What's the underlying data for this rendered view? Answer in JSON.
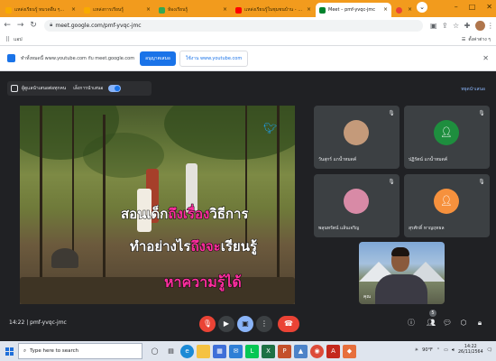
{
  "browser": {
    "tabs": [
      {
        "label": "แหล่งเรียนรู้ หมวดอื่น ๆ...",
        "favicon_color": "#f9ab00",
        "active": false
      },
      {
        "label": "แหล่งการเรียนรู้",
        "favicon_color": "#f9ab00",
        "active": false
      },
      {
        "label": "ห้องเรียนรู้",
        "favicon_color": "#34a853",
        "active": false
      },
      {
        "label": "แหล่งเรียนรู้ในชุมชนบ้าน - YouTube",
        "favicon_color": "#ff0000",
        "active": false
      },
      {
        "label": "Meet – pmf-yvqc-jmc",
        "favicon_color": "#00832d",
        "active": true
      },
      {
        "label": "",
        "favicon_color": "#ea4335",
        "active": false
      }
    ],
    "new_tab": "+",
    "url": "meet.google.com/pmf-yvqc-jmc",
    "bookmarks_label": "แอป",
    "bookmarks_right": "ตั้งค่าต่าง ๆ"
  },
  "infobar": {
    "text": "ทำทั้งหมดนี้ www.youtube.com กับ meet.google.com",
    "primary_label": "อนุญาตเสมอ",
    "secondary_label": "ใช้งาน www.youtube.com"
  },
  "meet": {
    "host_label": "ผู้ดูแลนำเสนอต่อทุกคน",
    "toggle_label": "เล็งการนำเสนอ",
    "host_link": "หยุดนำเสนอ",
    "overlay": {
      "line1_a": "สอนเด็ก",
      "line1_b": "ถึงเรื่อง",
      "line1_c": "วิธีการ",
      "line2_a": "ทำอย่างไร",
      "line2_b": "ถึงจะ",
      "line2_c": "เรียนรู้",
      "line3": "หาความรู้ได้"
    },
    "participants": [
      {
        "name": "วันสุกร์ แกน้ำหมดค์",
        "initial": "",
        "avatar_color": "#c49a7a"
      },
      {
        "name": "ปฏิรัตน์ แกน้ำหมดค์",
        "initial": "",
        "avatar_color": "#1e8e3e"
      },
      {
        "name": "พลุนทรัตน์ แล้นเจริญ",
        "initial": "",
        "avatar_color": "#d88aa6"
      },
      {
        "name": "สุรศักดิ์ หาญฤทธล",
        "initial": "",
        "avatar_color": "#f6913d"
      }
    ],
    "self_name": "คุณ",
    "time": "14:22",
    "meeting_code": "pmf-yvqc-jmc",
    "badge_count": "5"
  },
  "taskbar": {
    "search_placeholder": "Type here to search",
    "temperature": "90°F",
    "time": "14:22",
    "date": "26/11/2564"
  },
  "colors": {
    "tab_strip": "#f29b1d",
    "meet_bg": "#202124",
    "hangup": "#ea4335",
    "present": "#8ab4f8"
  }
}
